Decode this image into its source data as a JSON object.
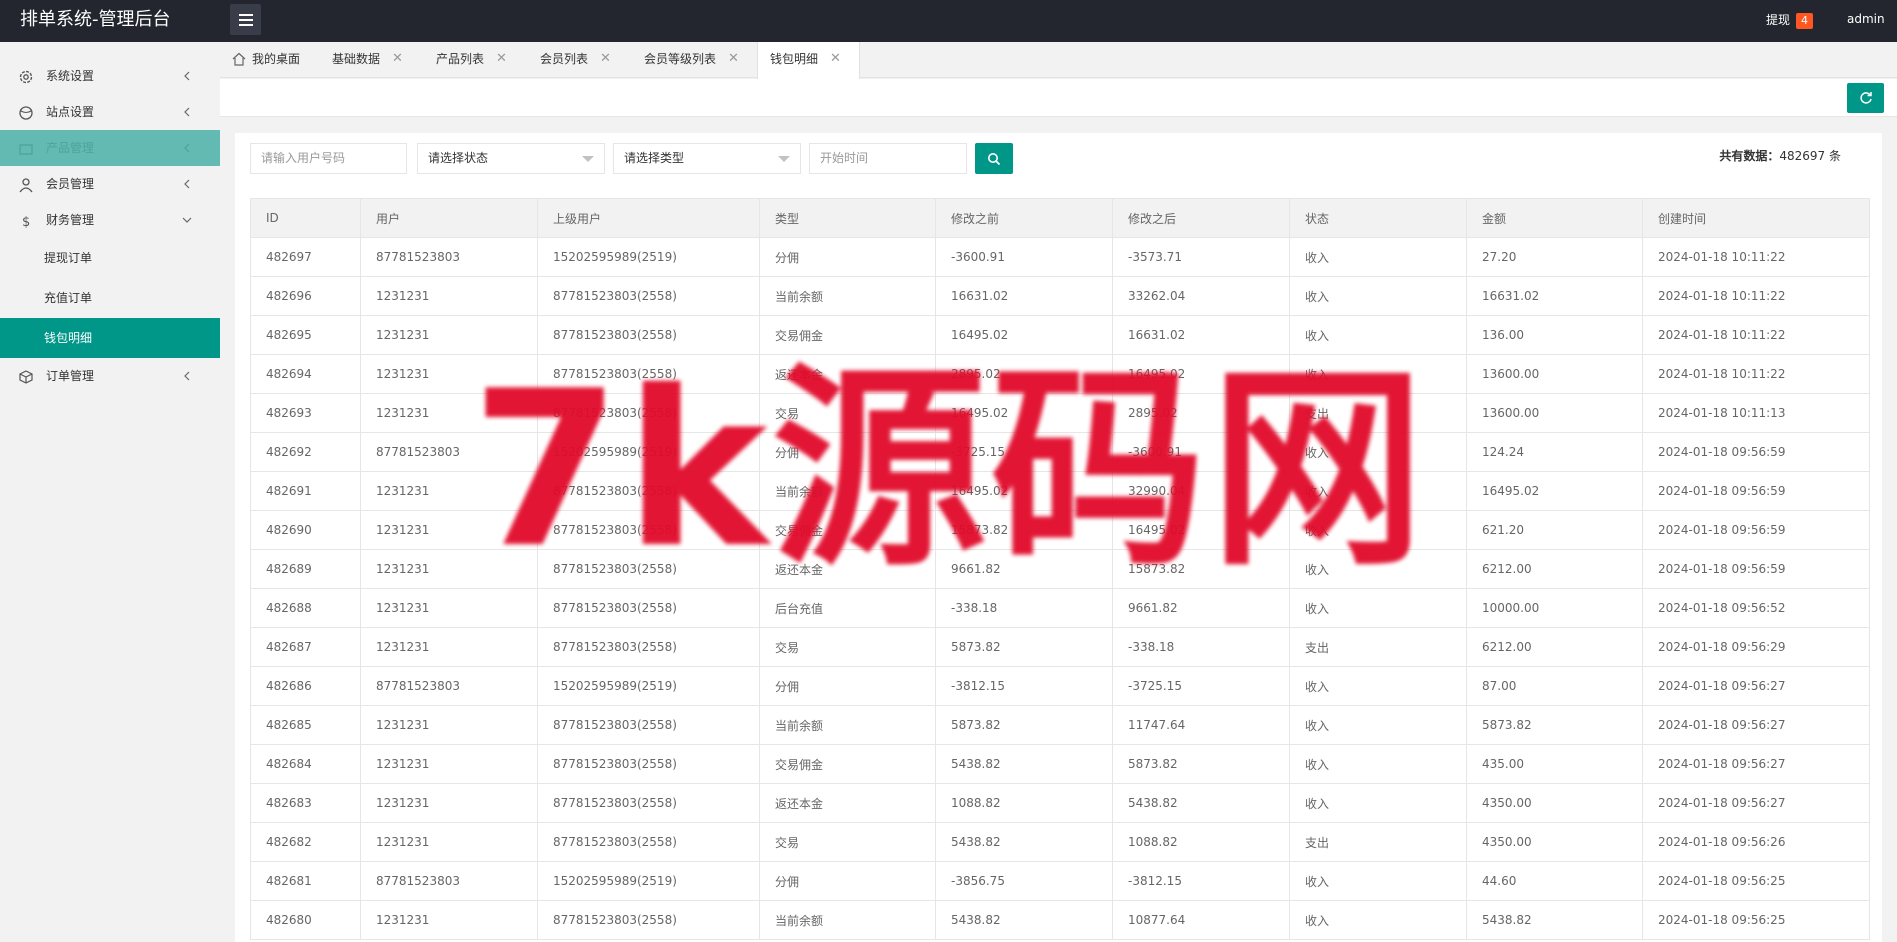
{
  "header": {
    "title": "排单系统-管理后台",
    "withdraw_label": "提现",
    "withdraw_count": "4",
    "user": "admin"
  },
  "sidebar": {
    "items": [
      {
        "label": "系统设置",
        "icon": "gear-icon"
      },
      {
        "label": "站点设置",
        "icon": "globe-icon"
      },
      {
        "label": "产品管理",
        "icon": "box-icon"
      },
      {
        "label": "会员管理",
        "icon": "user-icon"
      },
      {
        "label": "财务管理",
        "icon": "dollar-icon"
      }
    ],
    "finance_sub": [
      {
        "label": "提现订单"
      },
      {
        "label": "充值订单"
      },
      {
        "label": "钱包明细"
      }
    ],
    "last_item": {
      "label": "订单管理",
      "icon": "cube-icon"
    }
  },
  "tabs": [
    {
      "label": "我的桌面"
    },
    {
      "label": "基础数据"
    },
    {
      "label": "产品列表"
    },
    {
      "label": "会员列表"
    },
    {
      "label": "会员等级列表"
    },
    {
      "label": "钱包明细"
    }
  ],
  "filters": {
    "user_placeholder": "请输入用户号码",
    "status_label": "请选择状态",
    "type_label": "请选择类型",
    "time_placeholder": "开始时间",
    "total_label": "共有数据：",
    "total_value": "482697",
    "total_unit": "条"
  },
  "table": {
    "columns": [
      "ID",
      "用户",
      "上级用户",
      "类型",
      "修改之前",
      "修改之后",
      "状态",
      "金额",
      "创建时间"
    ],
    "rows": [
      [
        "482697",
        "87781523803",
        "15202595989(2519)",
        "分佣",
        "-3600.91",
        "-3573.71",
        "收入",
        "27.20",
        "2024-01-18 10:11:22"
      ],
      [
        "482696",
        "1231231",
        "87781523803(2558)",
        "当前余额",
        "16631.02",
        "33262.04",
        "收入",
        "16631.02",
        "2024-01-18 10:11:22"
      ],
      [
        "482695",
        "1231231",
        "87781523803(2558)",
        "交易佣金",
        "16495.02",
        "16631.02",
        "收入",
        "136.00",
        "2024-01-18 10:11:22"
      ],
      [
        "482694",
        "1231231",
        "87781523803(2558)",
        "返还本金",
        "2895.02",
        "16495.02",
        "收入",
        "13600.00",
        "2024-01-18 10:11:22"
      ],
      [
        "482693",
        "1231231",
        "87781523803(2558)",
        "交易",
        "16495.02",
        "2895.02",
        "支出",
        "13600.00",
        "2024-01-18 10:11:13"
      ],
      [
        "482692",
        "87781523803",
        "15202595989(2519)",
        "分佣",
        "-3725.15",
        "-3600.91",
        "收入",
        "124.24",
        "2024-01-18 09:56:59"
      ],
      [
        "482691",
        "1231231",
        "87781523803(2558)",
        "当前余额",
        "16495.02",
        "32990.04",
        "收入",
        "16495.02",
        "2024-01-18 09:56:59"
      ],
      [
        "482690",
        "1231231",
        "87781523803(2558)",
        "交易佣金",
        "15873.82",
        "16495.02",
        "收入",
        "621.20",
        "2024-01-18 09:56:59"
      ],
      [
        "482689",
        "1231231",
        "87781523803(2558)",
        "返还本金",
        "9661.82",
        "15873.82",
        "收入",
        "6212.00",
        "2024-01-18 09:56:59"
      ],
      [
        "482688",
        "1231231",
        "87781523803(2558)",
        "后台充值",
        "-338.18",
        "9661.82",
        "收入",
        "10000.00",
        "2024-01-18 09:56:52"
      ],
      [
        "482687",
        "1231231",
        "87781523803(2558)",
        "交易",
        "5873.82",
        "-338.18",
        "支出",
        "6212.00",
        "2024-01-18 09:56:29"
      ],
      [
        "482686",
        "87781523803",
        "15202595989(2519)",
        "分佣",
        "-3812.15",
        "-3725.15",
        "收入",
        "87.00",
        "2024-01-18 09:56:27"
      ],
      [
        "482685",
        "1231231",
        "87781523803(2558)",
        "当前余额",
        "5873.82",
        "11747.64",
        "收入",
        "5873.82",
        "2024-01-18 09:56:27"
      ],
      [
        "482684",
        "1231231",
        "87781523803(2558)",
        "交易佣金",
        "5438.82",
        "5873.82",
        "收入",
        "435.00",
        "2024-01-18 09:56:27"
      ],
      [
        "482683",
        "1231231",
        "87781523803(2558)",
        "返还本金",
        "1088.82",
        "5438.82",
        "收入",
        "4350.00",
        "2024-01-18 09:56:27"
      ],
      [
        "482682",
        "1231231",
        "87781523803(2558)",
        "交易",
        "5438.82",
        "1088.82",
        "支出",
        "4350.00",
        "2024-01-18 09:56:26"
      ],
      [
        "482681",
        "87781523803",
        "15202595989(2519)",
        "分佣",
        "-3856.75",
        "-3812.15",
        "收入",
        "44.60",
        "2024-01-18 09:56:25"
      ],
      [
        "482680",
        "1231231",
        "87781523803(2558)",
        "当前余额",
        "5438.82",
        "10877.64",
        "收入",
        "5438.82",
        "2024-01-18 09:56:25"
      ]
    ]
  },
  "watermark": "7k源码网",
  "colors": {
    "header_bg": "#23262e",
    "accent": "#009688",
    "badge": "#ff5722",
    "watermark": "#e10a2a"
  }
}
